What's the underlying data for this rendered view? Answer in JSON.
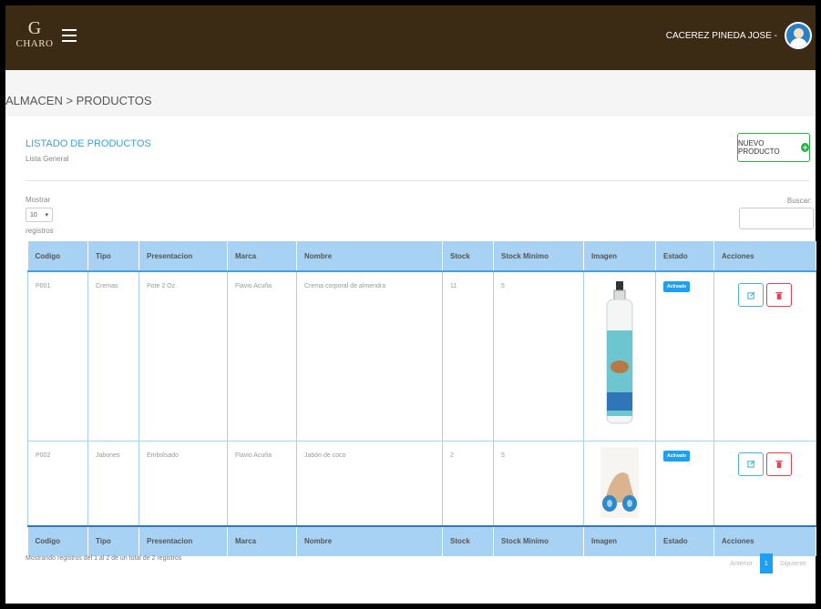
{
  "header": {
    "logo_text": "CHARO",
    "user_name": "CACEREZ PINEDA JOSE -"
  },
  "breadcrumb": "ALMACEN > PRODUCTOS",
  "card": {
    "title": "LISTADO DE PRODUCTOS",
    "subtitle": "Lista General",
    "new_button": "NUEVO PRODUCTO"
  },
  "controls": {
    "show_label": "Mostrar",
    "page_size": "10",
    "records_label": "registros",
    "search_label": "Buscar:",
    "search_value": ""
  },
  "table": {
    "columns": [
      "Codigo",
      "Tipo",
      "Presentacion",
      "Marca",
      "Nombre",
      "Stock",
      "Stock Minimo",
      "Imagen",
      "Estado",
      "Acciones"
    ],
    "rows": [
      {
        "codigo": "P001",
        "tipo": "Cremas",
        "presentacion": "Pote 2 Oz.",
        "marca": "Flavio Acuña",
        "nombre": "Crema corporal de almendra",
        "stock": "11",
        "stock_minimo": "5",
        "estado": "Activado"
      },
      {
        "codigo": "P002",
        "tipo": "Jabones",
        "presentacion": "Embolsado",
        "marca": "Flavio Acuña",
        "nombre": "Jabón de coco",
        "stock": "2",
        "stock_minimo": "5",
        "estado": "Activado"
      }
    ]
  },
  "footer": {
    "info": "Mostrando registros del 1 al 2 de un total de 2 registros",
    "prev": "Anterior",
    "page": "1",
    "next": "Siguiente"
  },
  "colors": {
    "topbar": "#3b2a14",
    "table_header": "#a8d2f3",
    "badge": "#1e9ff2",
    "new_button_border": "#2fae4a",
    "edit_border": "#42b4d6",
    "delete_border": "#e8404f"
  },
  "icons": [
    "menu-icon",
    "plus-circle-icon",
    "edit-icon",
    "trash-icon",
    "select-chevron-icon"
  ]
}
